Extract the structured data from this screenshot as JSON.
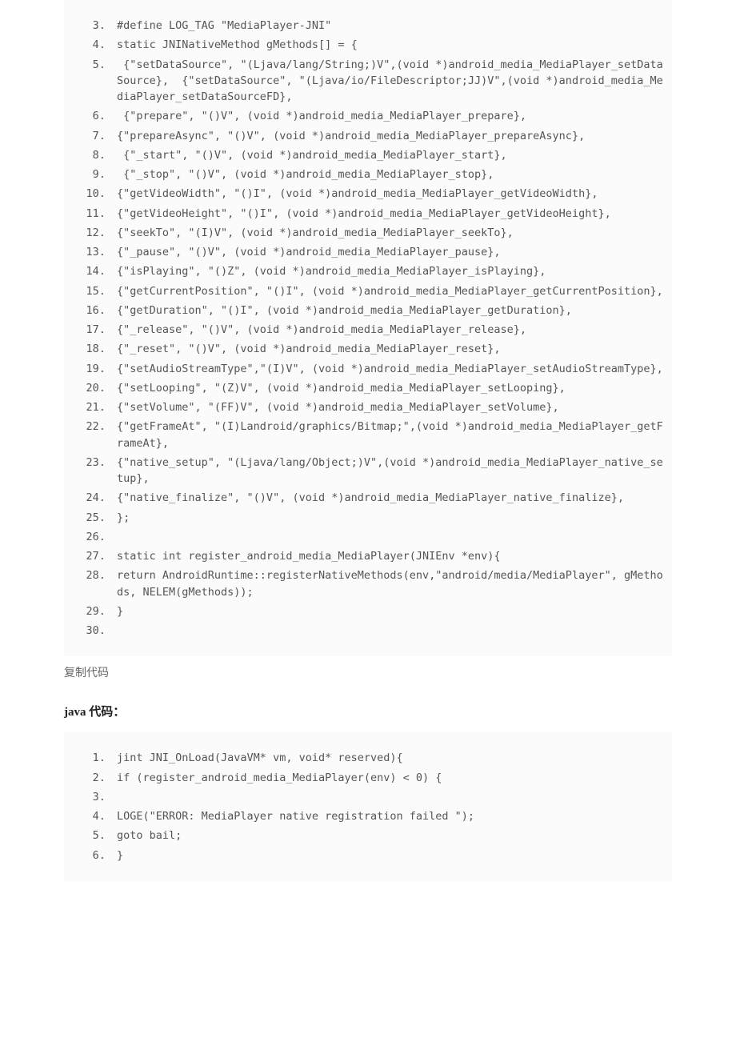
{
  "block1": [
    "#define LOG_TAG \"MediaPlayer-JNI\"",
    "static JNINativeMethod gMethods[] = {",
    " {\"setDataSource\", \"(Ljava/lang/String;)V\",(void *)android_media_MediaPlayer_setDataSource},  {\"setDataSource\", \"(Ljava/io/FileDescriptor;JJ)V\",(void *)android_media_MediaPlayer_setDataSourceFD},",
    " {\"prepare\", \"()V\", (void *)android_media_MediaPlayer_prepare},",
    "{\"prepareAsync\", \"()V\", (void *)android_media_MediaPlayer_prepareAsync},",
    " {\"_start\", \"()V\", (void *)android_media_MediaPlayer_start},",
    " {\"_stop\", \"()V\", (void *)android_media_MediaPlayer_stop},",
    "{\"getVideoWidth\", \"()I\", (void *)android_media_MediaPlayer_getVideoWidth},",
    "{\"getVideoHeight\", \"()I\", (void *)android_media_MediaPlayer_getVideoHeight},",
    "{\"seekTo\", \"(I)V\", (void *)android_media_MediaPlayer_seekTo},",
    "{\"_pause\", \"()V\", (void *)android_media_MediaPlayer_pause},",
    "{\"isPlaying\", \"()Z\", (void *)android_media_MediaPlayer_isPlaying},",
    "{\"getCurrentPosition\", \"()I\", (void *)android_media_MediaPlayer_getCurrentPosition},",
    "{\"getDuration\", \"()I\", (void *)android_media_MediaPlayer_getDuration},",
    "{\"_release\", \"()V\", (void *)android_media_MediaPlayer_release},",
    "{\"_reset\", \"()V\", (void *)android_media_MediaPlayer_reset},",
    "{\"setAudioStreamType\",\"(I)V\", (void *)android_media_MediaPlayer_setAudioStreamType},",
    "{\"setLooping\", \"(Z)V\", (void *)android_media_MediaPlayer_setLooping},",
    "{\"setVolume\", \"(FF)V\", (void *)android_media_MediaPlayer_setVolume},",
    "{\"getFrameAt\", \"(I)Landroid/graphics/Bitmap;\",(void *)android_media_MediaPlayer_getFrameAt},",
    "{\"native_setup\", \"(Ljava/lang/Object;)V\",(void *)android_media_MediaPlayer_native_setup},",
    "{\"native_finalize\", \"()V\", (void *)android_media_MediaPlayer_native_finalize},",
    "};",
    "",
    "static int register_android_media_MediaPlayer(JNIEnv *env){",
    "return AndroidRuntime::registerNativeMethods(env,\"android/media/MediaPlayer\", gMethods, NELEM(gMethods));",
    "}",
    ""
  ],
  "copy_label": "复制代码",
  "heading2": "java 代码：",
  "block2": [
    "jint JNI_OnLoad(JavaVM* vm, void* reserved){",
    "if (register_android_media_MediaPlayer(env) < 0) {",
    "",
    "LOGE(\"ERROR: MediaPlayer native registration failed \");",
    "goto bail;",
    "}"
  ]
}
